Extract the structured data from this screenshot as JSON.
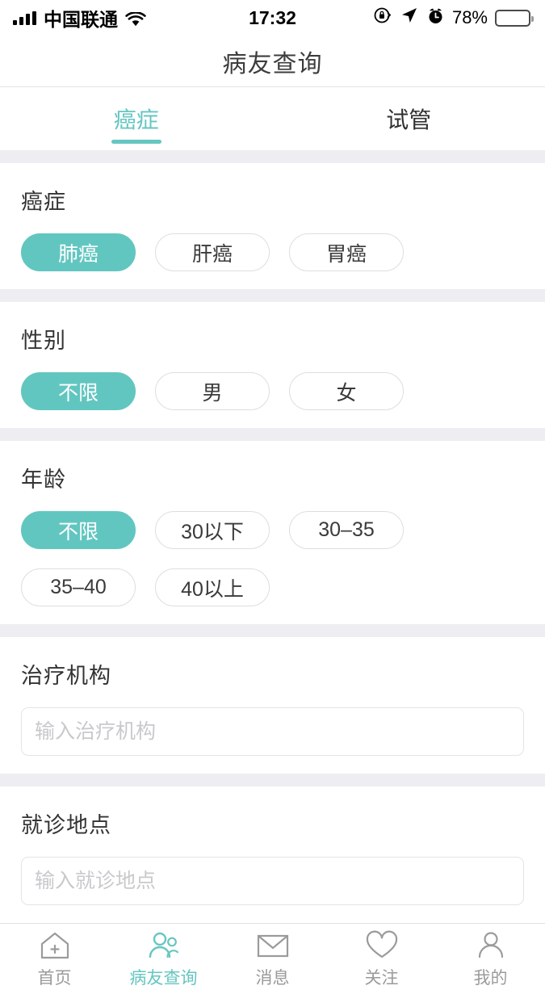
{
  "status_bar": {
    "carrier": "中国联通",
    "time": "17:32",
    "battery_percent": "78%",
    "icons": [
      "signal-bars-icon",
      "wifi-icon",
      "rotation-lock-icon",
      "location-arrow-icon",
      "alarm-clock-icon",
      "battery-icon"
    ]
  },
  "navbar": {
    "title": "病友查询"
  },
  "tabs": [
    {
      "label": "癌症",
      "active": true
    },
    {
      "label": "试管",
      "active": false
    }
  ],
  "sections": {
    "cancer": {
      "title": "癌症",
      "options": [
        {
          "label": "肺癌",
          "selected": true
        },
        {
          "label": "肝癌",
          "selected": false
        },
        {
          "label": "胃癌",
          "selected": false
        }
      ]
    },
    "gender": {
      "title": "性别",
      "options": [
        {
          "label": "不限",
          "selected": true
        },
        {
          "label": "男",
          "selected": false
        },
        {
          "label": "女",
          "selected": false
        }
      ]
    },
    "age": {
      "title": "年龄",
      "options": [
        {
          "label": "不限",
          "selected": true
        },
        {
          "label": "30以下",
          "selected": false
        },
        {
          "label": "30–35",
          "selected": false
        },
        {
          "label": "35–40",
          "selected": false
        },
        {
          "label": "40以上",
          "selected": false
        }
      ]
    },
    "hospital": {
      "title": "治疗机构",
      "input_placeholder": "输入治疗机构",
      "input_value": ""
    },
    "location": {
      "title": "就诊地点",
      "input_placeholder": "输入就诊地点",
      "input_value": ""
    }
  },
  "tabbar": [
    {
      "label": "首页",
      "icon": "home-plus-icon",
      "active": false
    },
    {
      "label": "病友查询",
      "icon": "people-icon",
      "active": true
    },
    {
      "label": "消息",
      "icon": "envelope-icon",
      "active": false
    },
    {
      "label": "关注",
      "icon": "heart-icon",
      "active": false
    },
    {
      "label": "我的",
      "icon": "person-icon",
      "active": false
    }
  ],
  "colors": {
    "accent": "#62c6c0",
    "band": "#eeeef2",
    "chip_border": "#dedee2",
    "text": "#333333",
    "muted": "#9b9b9b"
  }
}
